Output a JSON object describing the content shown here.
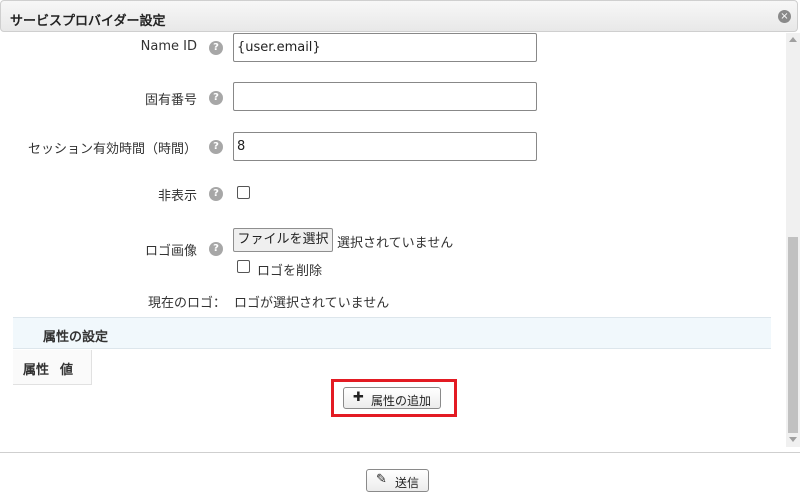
{
  "dialog": {
    "title": "サービスプロバイダー設定",
    "close_icon": "×"
  },
  "form": {
    "name_id": {
      "label": "Name ID",
      "value": "{user.email}"
    },
    "unique_number": {
      "label": "固有番号",
      "value": ""
    },
    "session_hours": {
      "label": "セッション有効時間（時間）",
      "value": "8"
    },
    "hidden": {
      "label": "非表示",
      "checked": false
    },
    "logo_image": {
      "label": "ロゴ画像",
      "file_button_label": "ファイルを選択",
      "file_status": "選択されていません",
      "delete_logo_label": "ロゴを削除"
    },
    "current_logo": {
      "label": "現在のロゴ：",
      "value": "ロゴが選択されていません"
    }
  },
  "attributes_section": {
    "title": "属性の設定",
    "columns": [
      "属性",
      "値"
    ],
    "add_button_label": "属性の追加",
    "add_icon": "plus-icon"
  },
  "footer": {
    "submit_label": "送信",
    "submit_icon": "pencil-icon"
  },
  "icons": {
    "help_symbol": "?"
  },
  "colors": {
    "highlight_border": "#e31b23",
    "section_header_bg": "#f1f8fc"
  }
}
